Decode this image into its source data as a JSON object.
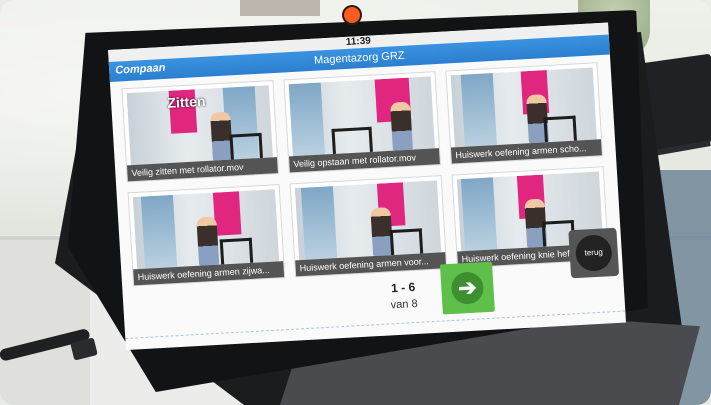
{
  "device": {
    "time": "11:39",
    "brand": "Compaan",
    "app_title": "Magentazorg GRZ"
  },
  "tiles": [
    {
      "caption": "Veilig zitten met rollator.mov",
      "overlay_text": "Zitten"
    },
    {
      "caption": "Veilig opstaan met rollator.mov",
      "overlay_text": ""
    },
    {
      "caption": "Huiswerk oefening armen scho...",
      "overlay_text": ""
    },
    {
      "caption": "Huiswerk oefening armen zijwa...",
      "overlay_text": ""
    },
    {
      "caption": "Huiswerk oefening armen voor...",
      "overlay_text": ""
    },
    {
      "caption": "Huiswerk oefening knie heffen ...",
      "overlay_text": ""
    }
  ],
  "pager": {
    "range": "1 - 6",
    "of": "van 8"
  },
  "buttons": {
    "next_icon": "arrow-right-icon",
    "back_label": "terug"
  },
  "colors": {
    "titlebar": "#2b7fd0",
    "next_button": "#5fbf4b",
    "camera": "#ff5a1f",
    "banner": "#e0267e"
  }
}
